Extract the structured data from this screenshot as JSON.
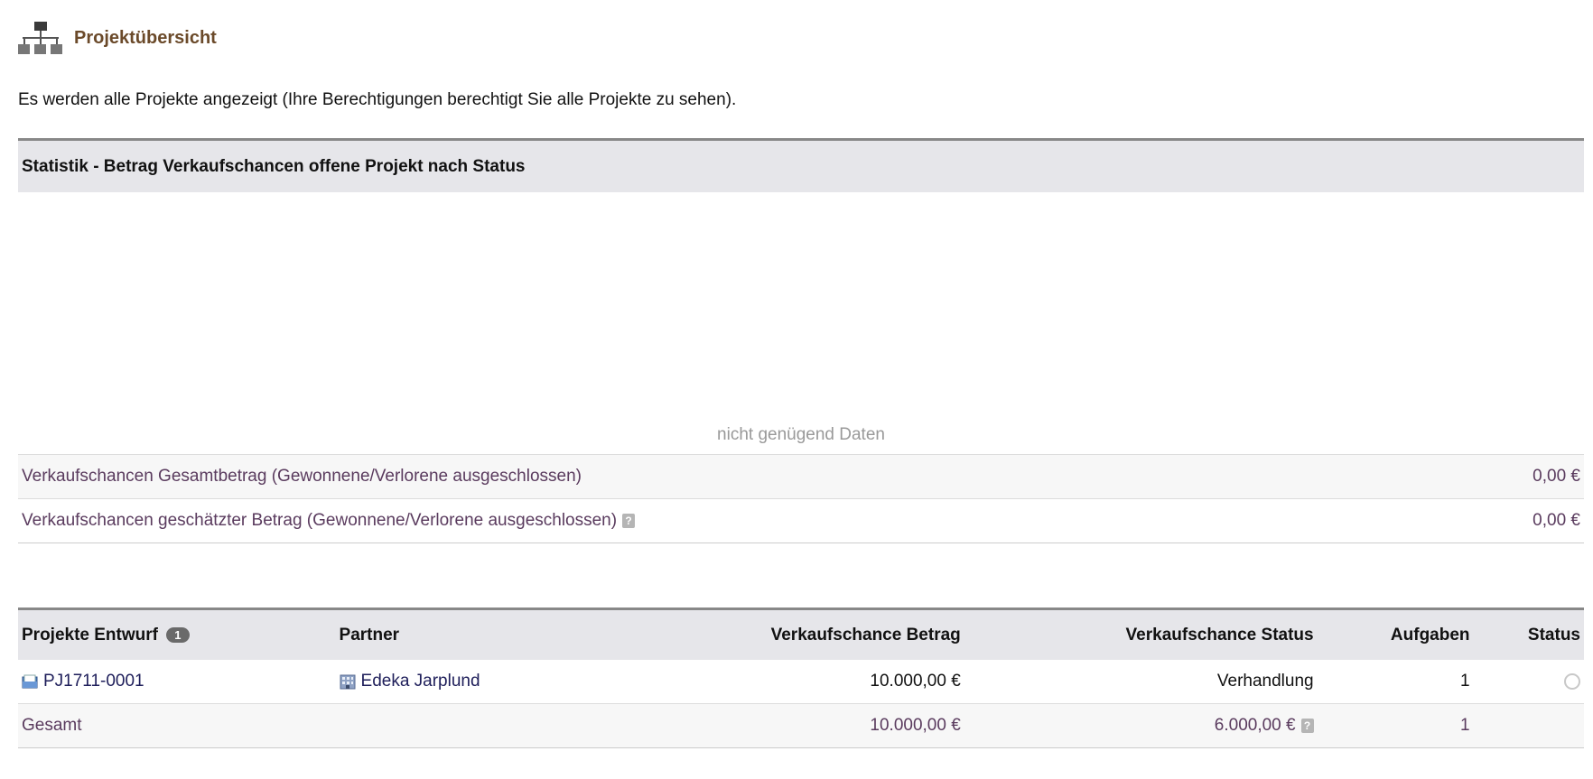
{
  "header": {
    "title": "Projektübersicht",
    "icon": "org-hierarchy-icon"
  },
  "intro": "Es werden alle Projekte angezeigt (Ihre Berechtigungen berechtigt Sie alle Projekte zu sehen).",
  "stats": {
    "title": "Statistik - Betrag Verkaufschancen offene Projekt nach Status",
    "no_data": "nicht genügend Daten",
    "rows": [
      {
        "label": "Verkaufschancen Gesamtbetrag (Gewonnene/Verlorene ausgeschlossen)",
        "value": "0,00 €"
      },
      {
        "label": "Verkaufschancen geschätzter Betrag (Gewonnene/Verlorene ausgeschlossen)",
        "value": "0,00 €",
        "help": "?"
      }
    ]
  },
  "projects": {
    "columns": {
      "entwurf": "Projekte Entwurf",
      "entwurf_count": "1",
      "partner": "Partner",
      "betrag": "Verkaufschance Betrag",
      "vk_status": "Verkaufschance Status",
      "aufgaben": "Aufgaben",
      "status": "Status"
    },
    "rows": [
      {
        "ref": "PJ1711-0001",
        "partner": "Edeka Jarplund",
        "betrag": "10.000,00 €",
        "vk_status": "Verhandlung",
        "aufgaben": "1"
      }
    ],
    "total": {
      "label": "Gesamt",
      "betrag": "10.000,00 €",
      "geschaetzt": "6.000,00 €",
      "aufgaben": "1",
      "help": "?"
    }
  },
  "colors": {
    "title": "#6b4a2a",
    "link": "#1e1e5a",
    "muted_value": "#5a3b5e",
    "header_bg": "#e6e6ea"
  }
}
